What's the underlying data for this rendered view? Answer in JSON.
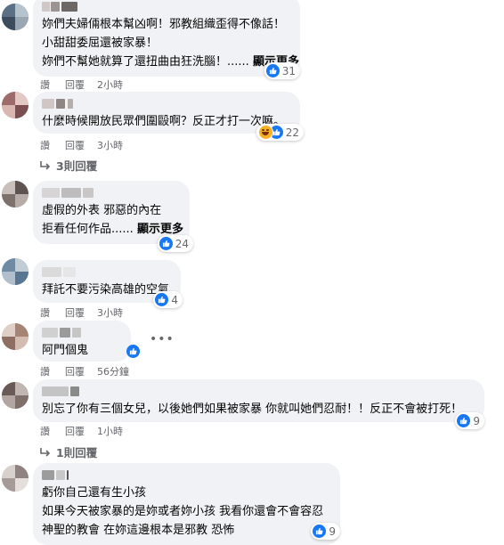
{
  "comments": [
    {
      "lines": [
        "妳們夫婦倆根本幫凶啊！邪教組織歪得不像話！",
        "小甜甜委屈還被家暴！",
        "妳們不幫她就算了還扭曲由狂洗腦！......"
      ],
      "see_more": "顯示更多",
      "reactions": "31",
      "actions": {
        "like": "讚",
        "reply": "回覆",
        "time": "2小時"
      }
    },
    {
      "lines": [
        "什麼時候開放民眾們圍毆啊？反正才打一次嘛。"
      ],
      "reactions": "22",
      "actions": {
        "like": "讚",
        "reply": "回覆",
        "time": "3小時"
      },
      "replies_label": "3則回覆"
    },
    {
      "lines": [
        "虛假的外表 邪惡的內在",
        "拒看任何作品......"
      ],
      "see_more": "顯示更多",
      "reactions": "24",
      "actions": {
        "like": "讚",
        "reply": "回覆",
        "time": "3小時"
      }
    },
    {
      "lines": [
        "拜託不要污染高雄的空氣"
      ],
      "reactions": "4",
      "actions": {
        "like": "讚",
        "reply": "回覆",
        "time": "3小時"
      }
    },
    {
      "lines": [
        "阿門個鬼"
      ],
      "actions": {
        "like": "讚",
        "reply": "回覆",
        "time": "56分鐘"
      }
    },
    {
      "lines": [
        "別忘了你有三個女兒，以後她們如果被家暴 你就叫她們忍耐！！反正不會被打死！"
      ],
      "reactions": "9",
      "actions": {
        "like": "讚",
        "reply": "回覆",
        "time": "1小時"
      },
      "replies_label": "1則回覆"
    },
    {
      "lines": [
        "虧你自己還有生小孩",
        "如果今天被家暴的是妳或者妳小孩 我看你還會不會容忍",
        "神聖的教會 在妳這邊根本是邪教 恐怖"
      ],
      "reactions": "9"
    }
  ],
  "icons": {
    "like": "thumbs-up-icon",
    "haha": "haha-emoji-icon",
    "reply_arrow": "reply-arrow-icon",
    "more": "more-options-icon"
  },
  "colors": {
    "like_blue": "#1877f2",
    "bubble": "#f0f2f5",
    "secondary_text": "#65676b"
  }
}
